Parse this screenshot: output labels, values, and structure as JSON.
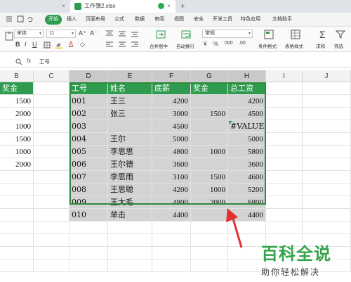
{
  "tabs": {
    "inactive_close": "×",
    "active_title": "工作簿2.xlsx",
    "active_close": "×",
    "new_tab": "+"
  },
  "menu": {
    "start": "开始",
    "items": [
      "插入",
      "页面布局",
      "公式",
      "数据",
      "审阅",
      "视图",
      "安全",
      "开发工具",
      "特色应用",
      "文档助手"
    ]
  },
  "toolbar": {
    "font_name": "宋体",
    "font_size": "11",
    "number_format": "常规",
    "labels": {
      "merge": "合并居中·",
      "wrap": "自动换行",
      "cond_format": "条件格式·",
      "table_style": "表格样式·",
      "sum": "求和·",
      "filter": "筛选"
    },
    "colors": {
      "font_color": "#e0312b",
      "fill_color": "#f5c518"
    }
  },
  "formula_bar": {
    "fx": "fx",
    "content": "工号"
  },
  "columns": [
    "B",
    "C",
    "D",
    "E",
    "F",
    "G",
    "H",
    "I",
    "J"
  ],
  "left_data": {
    "header": "奖金",
    "values": [
      "1500",
      "2000",
      "1000",
      "1500",
      "1000",
      "2000"
    ]
  },
  "table": {
    "headers": [
      "工号",
      "姓名",
      "底薪",
      "奖金",
      "总工资"
    ],
    "rows": [
      [
        "001",
        "王三",
        "4200",
        "",
        "4200"
      ],
      [
        "002",
        "张三",
        "3000",
        "1500",
        "4500"
      ],
      [
        "003",
        "",
        "4500",
        "",
        "#VALUE!"
      ],
      [
        "004",
        "王尔",
        "5000",
        "",
        "5000"
      ],
      [
        "005",
        "李思思",
        "4800",
        "1000",
        "5800"
      ],
      [
        "006",
        "王尔德",
        "3600",
        "",
        "3600"
      ],
      [
        "007",
        "李思雨",
        "3100",
        "1500",
        "4600"
      ],
      [
        "008",
        "王思聪",
        "4200",
        "1000",
        "5200"
      ],
      [
        "009",
        "王大毛",
        "4800",
        "2000",
        "6800"
      ],
      [
        "010",
        "单击",
        "4400",
        "",
        "4400"
      ]
    ]
  },
  "watermark": {
    "main": "百科全说",
    "sub": "助你轻松解决"
  },
  "accent": "#2e9b4e",
  "arrow_color": "#e53030"
}
